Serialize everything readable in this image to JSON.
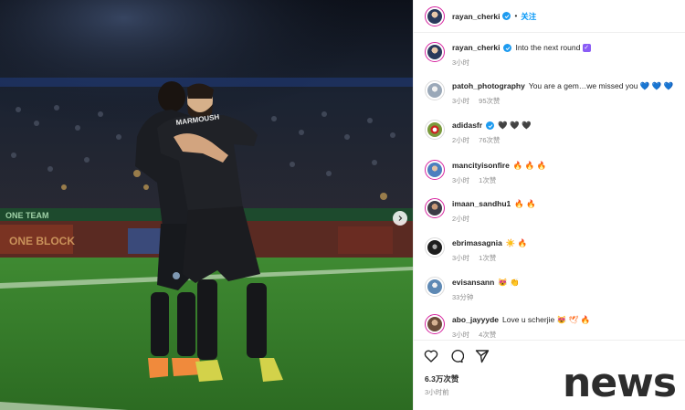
{
  "post": {
    "author": "rayan_cherki",
    "separator": "•",
    "follow_label": "关注",
    "caption_text": "Into the next round",
    "caption_time": "3小时"
  },
  "comments": [
    {
      "user": "patoh_photography",
      "text": "You are a gem…we missed you",
      "emoji": "💙 💙 💙",
      "time": "3小时",
      "likes": "95次赞",
      "verified": false
    },
    {
      "user": "adidasfr",
      "text": "",
      "emoji": "🖤 🖤 🖤",
      "time": "2小时",
      "likes": "76次赞",
      "verified": true
    },
    {
      "user": "mancityisonfire",
      "text": "",
      "emoji": "🔥 🔥 🔥",
      "time": "3小时",
      "likes": "1次赞",
      "verified": false
    },
    {
      "user": "imaan_sandhu1",
      "text": "",
      "emoji": "🔥 🔥",
      "time": "2小时",
      "likes": "",
      "verified": false
    },
    {
      "user": "ebrimasagnia",
      "text": "",
      "emoji": "☀️ 🔥",
      "time": "3小时",
      "likes": "1次赞",
      "verified": false
    },
    {
      "user": "evisansann",
      "text": "",
      "emoji": "😻 👏",
      "time": "33分钟",
      "likes": "",
      "verified": false
    },
    {
      "user": "abo_jayyyde",
      "text": "Love u scherjie",
      "emoji": "😻 🕊 🔥",
      "time": "3小时",
      "likes": "4次赞",
      "verified": false
    }
  ],
  "actions": {
    "likes_total": "6.3万次赞",
    "post_age": "3小时前"
  },
  "photo": {
    "shirt_name": "MARMOUSH",
    "board_text": "ONE TEAM",
    "board_text_2": "ONE BLOCK"
  },
  "watermark": "news",
  "icons": [
    "verified-badge-icon",
    "heart-icon",
    "comment-icon",
    "share-icon",
    "chevron-right-icon"
  ],
  "colors": {
    "accent": "#0095f6",
    "verified": "#1d9bf0",
    "muted": "#8e8e8e"
  }
}
